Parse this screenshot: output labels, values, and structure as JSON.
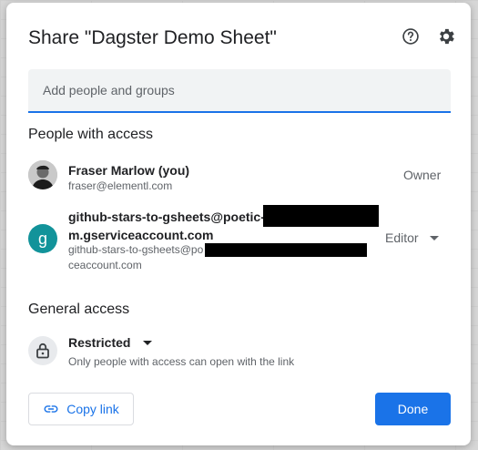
{
  "dialog": {
    "title": "Share \"Dagster Demo Sheet\"",
    "help_icon": "help-circle-icon",
    "settings_icon": "gear-icon"
  },
  "add_people": {
    "placeholder": "Add people and groups",
    "value": ""
  },
  "people_section": {
    "title": "People with access",
    "people": [
      {
        "name": "Fraser Marlow (you)",
        "email": "fraser@elementl.com",
        "role": "Owner",
        "avatar": "profile-photo"
      },
      {
        "name_line1": "github-stars-to-gsheets@poetic-f",
        "name_line2": "m.gserviceaccount.com",
        "email_line1": "github-stars-to-gsheets@po",
        "email_line2": "ceaccount.com",
        "role": "Editor",
        "avatar_letter": "g"
      }
    ]
  },
  "general_access": {
    "title": "General access",
    "level": "Restricted",
    "description": "Only people with access can open with the link",
    "icon": "lock-icon"
  },
  "footer": {
    "copy_link_label": "Copy link",
    "copy_link_icon": "link-icon",
    "done_label": "Done"
  },
  "colors": {
    "accent": "#1a73e8",
    "service_avatar": "#12939a"
  }
}
